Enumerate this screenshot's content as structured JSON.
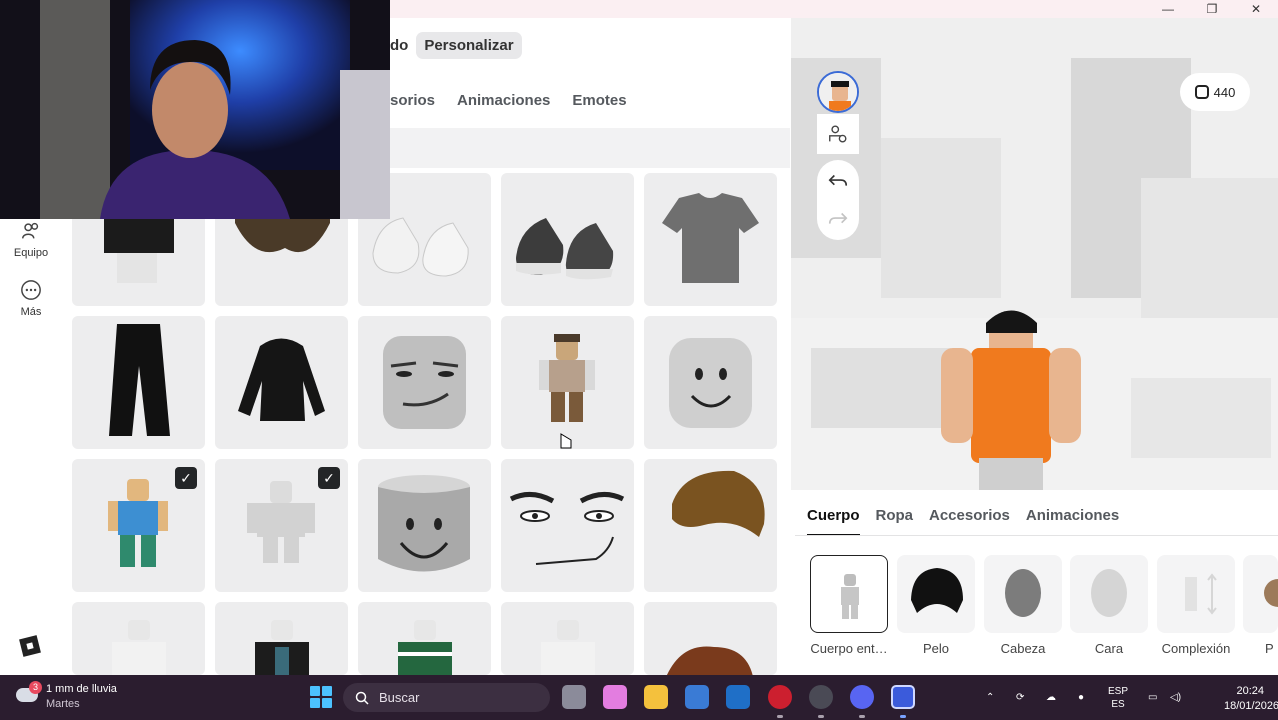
{
  "header": {
    "tab_cut": "do",
    "tab_active": "Personalizar"
  },
  "category_tabs": [
    "sorios",
    "Animaciones",
    "Emotes"
  ],
  "sidebar": {
    "items": [
      {
        "label": "Equipo",
        "icon": "outfit-icon"
      },
      {
        "label": "Más",
        "icon": "more-icon"
      }
    ],
    "logo": "roblox-logo"
  },
  "grid": {
    "checked_items": [
      "item-avatar-blue-outfit",
      "item-avatar-gray-outfit"
    ]
  },
  "preview": {
    "robux_amount": "440",
    "undo_icon": "undo-icon",
    "redo_icon": "redo-icon"
  },
  "bottom_panel": {
    "tabs": [
      "Cuerpo",
      "Ropa",
      "Accesorios",
      "Animaciones"
    ],
    "active_tab": "Cuerpo",
    "items": [
      {
        "label": "Cuerpo ent…"
      },
      {
        "label": "Pelo"
      },
      {
        "label": "Cabeza"
      },
      {
        "label": "Cara"
      },
      {
        "label": "Complexión"
      },
      {
        "label": "P"
      }
    ]
  },
  "taskbar": {
    "weather_line1": "1 mm de lluvia",
    "weather_line2": "Martes",
    "weather_badge": "3",
    "search_placeholder": "Buscar",
    "lang_line1": "ESP",
    "lang_line2": "ES",
    "time": "20:24",
    "date": "18/01/2026"
  },
  "colors": {
    "accent_blue": "#3b6bd6",
    "taskbar_bg": "#2b1d2f",
    "avatar_shirt": "#f07a1e"
  }
}
